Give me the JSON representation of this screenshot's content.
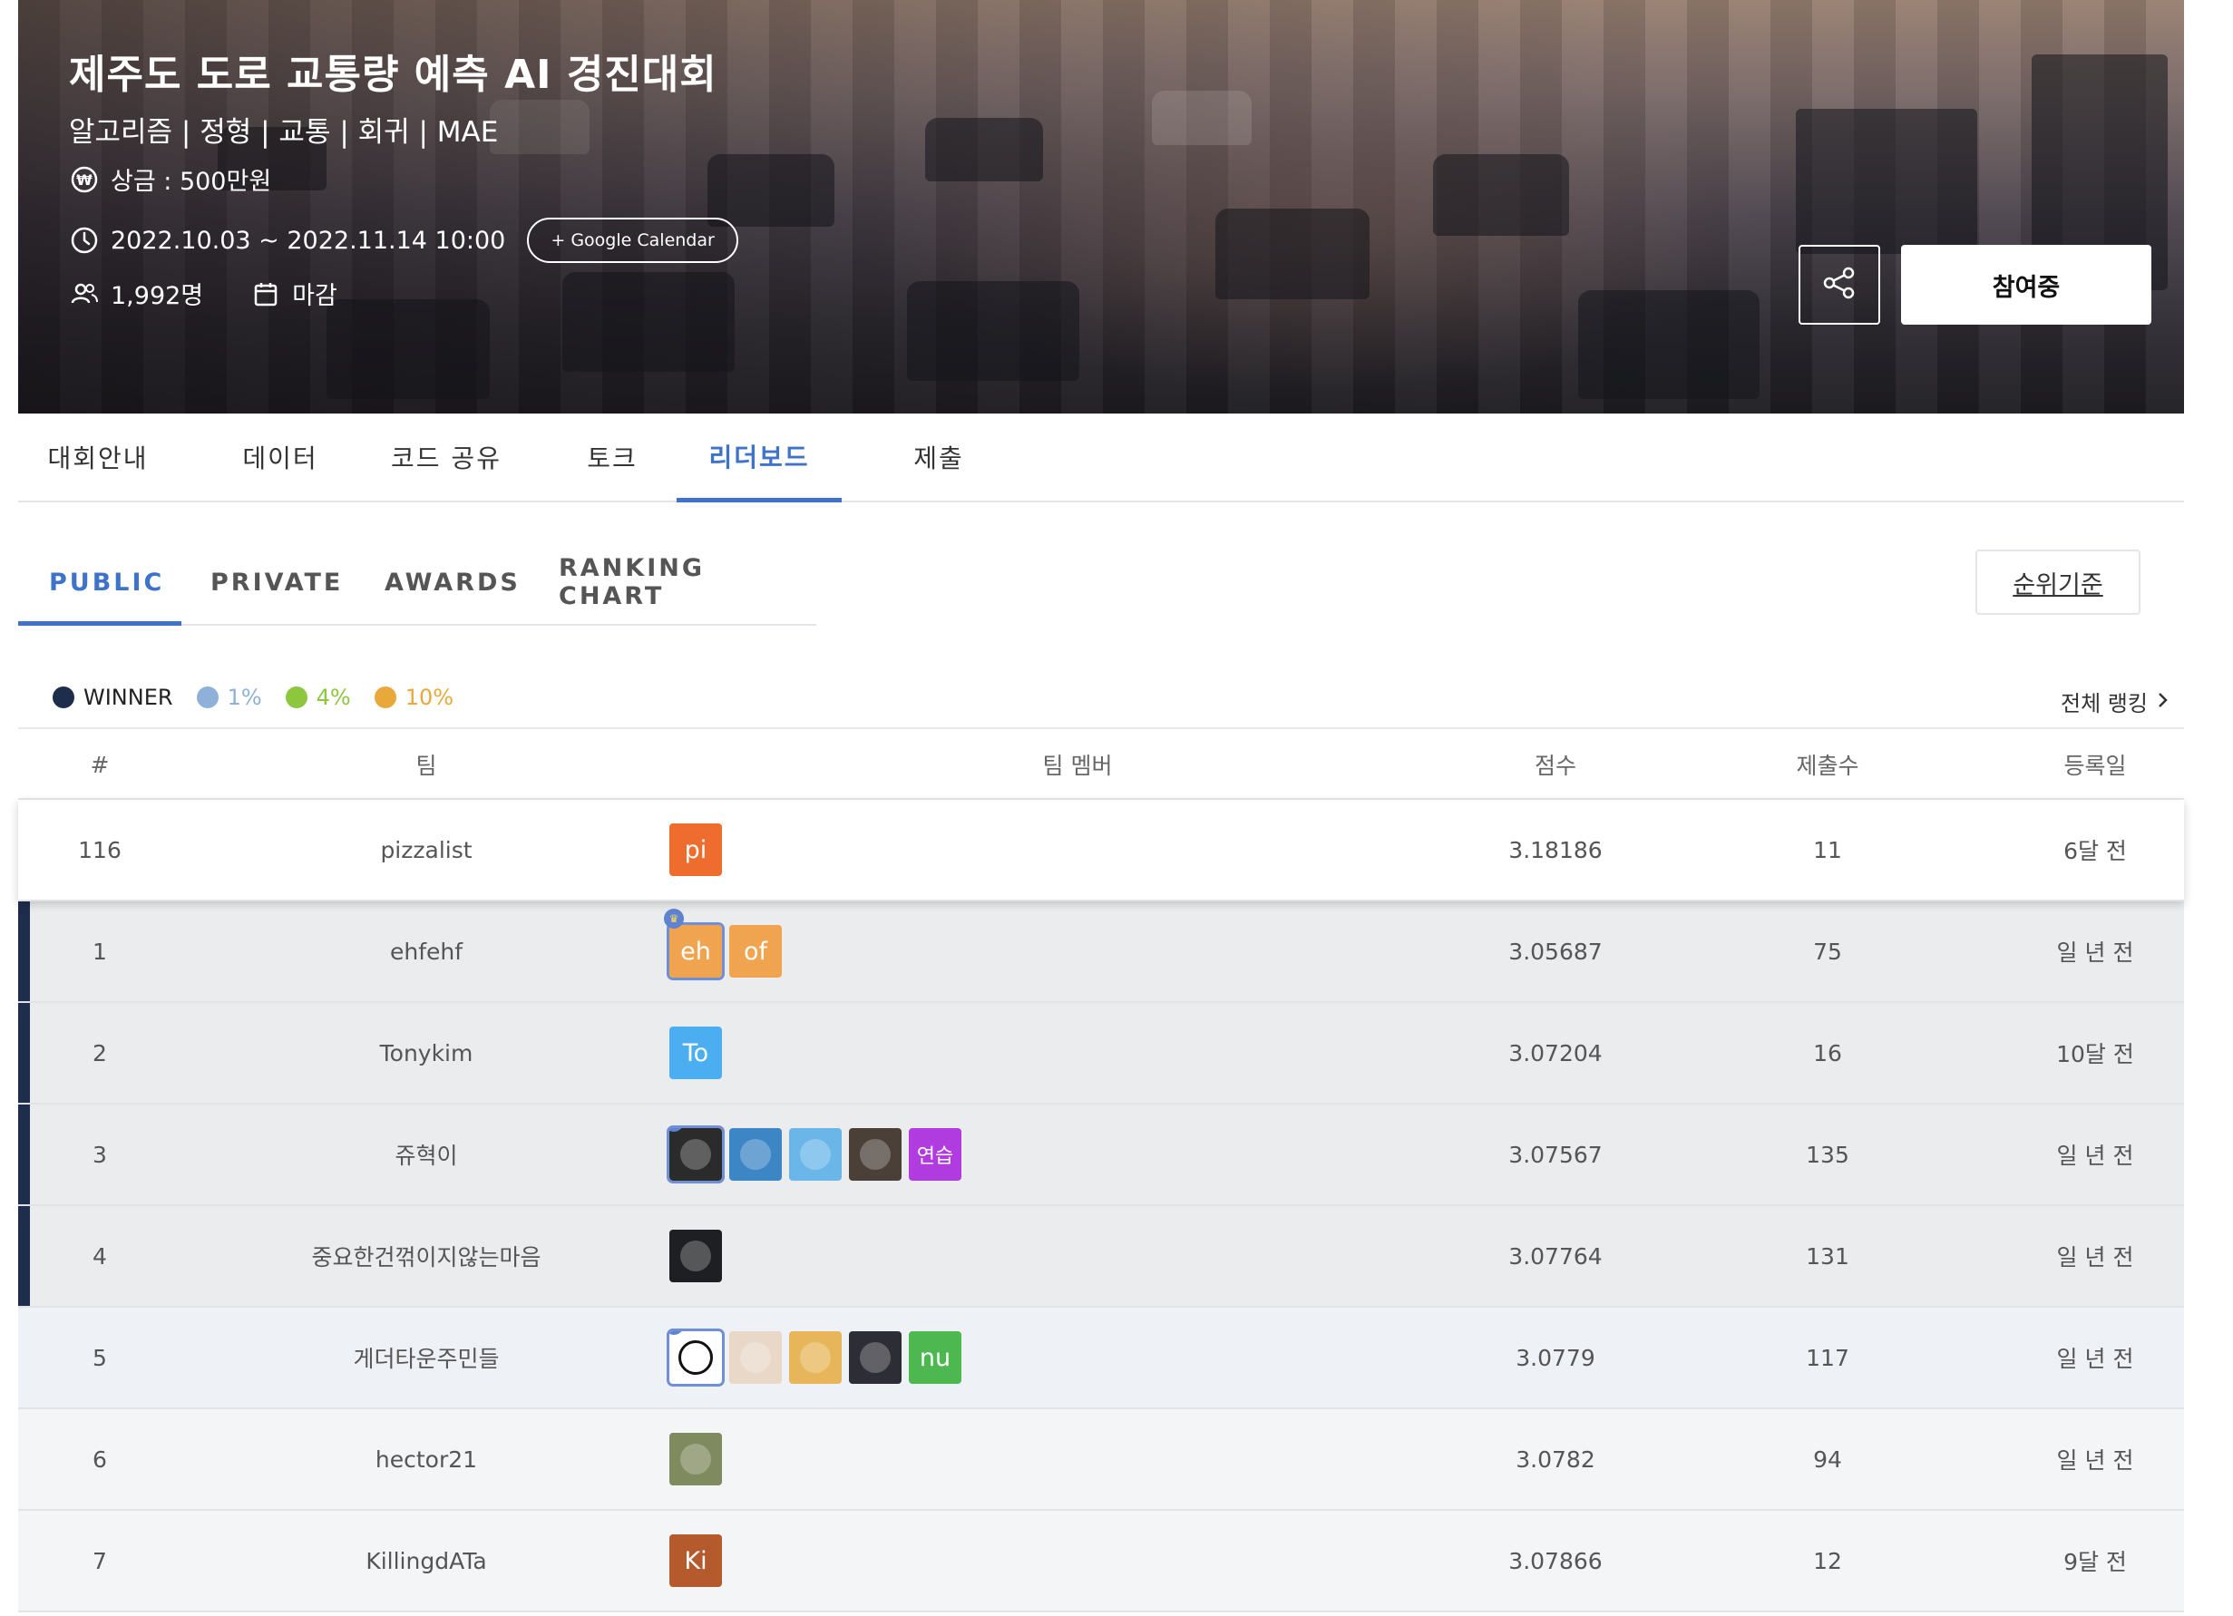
{
  "hero": {
    "title": "제주도 도로 교통량 예측 AI 경진대회",
    "tags": "알고리즘 | 정형 | 교통 | 회귀 | MAE",
    "prize": "상금 : 500만원",
    "period": "2022.10.03 ~ 2022.11.14 10:00",
    "google_calendar": "+ Google Calendar",
    "participants": "1,992명",
    "status": "마감",
    "join_label": "참여중"
  },
  "main_tabs": [
    "대회안내",
    "데이터",
    "코드 공유",
    "토크",
    "리더보드",
    "제출"
  ],
  "active_main_tab": "리더보드",
  "sub_tabs": [
    "PUBLIC",
    "PRIVATE",
    "AWARDS",
    "RANKING CHART"
  ],
  "active_sub_tab": "PUBLIC",
  "rank_criteria_label": "순위기준",
  "legend": [
    {
      "label": "WINNER",
      "color": "#1f2d4d"
    },
    {
      "label": "1%",
      "color": "#8fb0d8"
    },
    {
      "label": "4%",
      "color": "#8dc63f"
    },
    {
      "label": "10%",
      "color": "#e8a93a"
    }
  ],
  "full_ranking_label": "전체 랭킹",
  "table": {
    "headers": [
      "#",
      "팀",
      "팀 멤버",
      "점수",
      "제출수",
      "등록일"
    ],
    "rows": [
      {
        "rank": "116",
        "team": "pizzalist",
        "score": "3.18186",
        "subs": "11",
        "date": "6달 전",
        "tier": "me",
        "members": [
          {
            "text": "pi",
            "color": "#ef6c2f",
            "type": "text"
          }
        ]
      },
      {
        "rank": "1",
        "team": "ehfehf",
        "score": "3.05687",
        "subs": "75",
        "date": "일 년 전",
        "tier": "winner",
        "members": [
          {
            "text": "eh",
            "color": "#f0a450",
            "type": "text",
            "leader": true
          },
          {
            "text": "of",
            "color": "#f0a450",
            "type": "text"
          }
        ]
      },
      {
        "rank": "2",
        "team": "Tonykim",
        "score": "3.07204",
        "subs": "16",
        "date": "10달 전",
        "tier": "winner",
        "members": [
          {
            "text": "To",
            "color": "#4aaef0",
            "type": "text"
          }
        ]
      },
      {
        "rank": "3",
        "team": "쥬혁이",
        "score": "3.07567",
        "subs": "135",
        "date": "일 년 전",
        "tier": "winner",
        "members": [
          {
            "type": "image",
            "color": "#2b2b2b",
            "leader": true
          },
          {
            "type": "image",
            "color": "#3d86c6"
          },
          {
            "type": "image",
            "color": "#6ab6e8"
          },
          {
            "type": "image",
            "color": "#4a4038"
          },
          {
            "text": "연습",
            "color": "#b03ce0",
            "type": "text"
          }
        ]
      },
      {
        "rank": "4",
        "team": "중요한건꺾이지않는마음",
        "score": "3.07764",
        "subs": "131",
        "date": "일 년 전",
        "tier": "winner",
        "members": [
          {
            "type": "image",
            "color": "#1e1f22"
          }
        ]
      },
      {
        "rank": "5",
        "team": "게더타운주민들",
        "score": "3.0779",
        "subs": "117",
        "date": "일 년 전",
        "tier": "pct1",
        "members": [
          {
            "type": "image",
            "color": "#ffffff",
            "leader": true
          },
          {
            "type": "image",
            "color": "#e9d7c7"
          },
          {
            "type": "image",
            "color": "#e7b65a"
          },
          {
            "type": "image",
            "color": "#2d2d35"
          },
          {
            "text": "nu",
            "color": "#4cb84f",
            "type": "text"
          }
        ]
      },
      {
        "rank": "6",
        "team": "hector21",
        "score": "3.0782",
        "subs": "94",
        "date": "일 년 전",
        "tier": "normal",
        "members": [
          {
            "type": "image",
            "color": "#7f8a5e"
          }
        ]
      },
      {
        "rank": "7",
        "team": "KillingdATa",
        "score": "3.07866",
        "subs": "12",
        "date": "9달 전",
        "tier": "normal",
        "members": [
          {
            "text": "Ki",
            "color": "#b45a2c",
            "type": "text"
          }
        ]
      }
    ]
  }
}
